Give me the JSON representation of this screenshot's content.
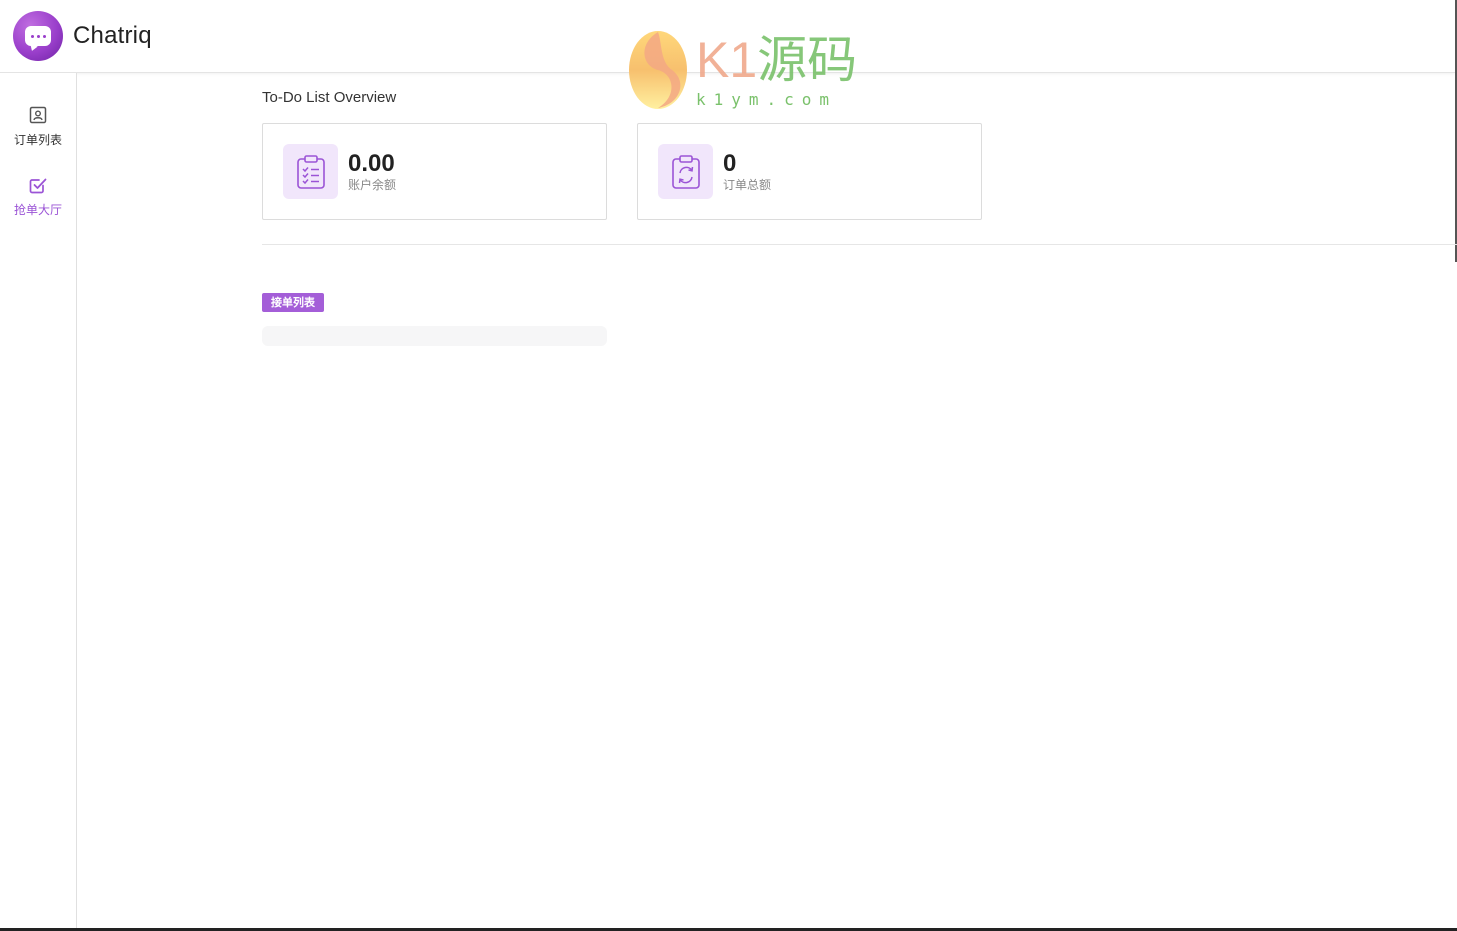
{
  "app": {
    "title": "Chatriq",
    "logo_icon": "chat-bubble-icon",
    "accent_color": "#9b54d6"
  },
  "watermark": {
    "brand_prefix": "K1",
    "brand_cn": "源码",
    "url": "k1ym.com"
  },
  "sidebar": {
    "items": [
      {
        "label": "订单列表",
        "icon": "order-list-icon",
        "active": false
      },
      {
        "label": "抢单大厅",
        "icon": "checkbox-icon",
        "active": true
      }
    ]
  },
  "main": {
    "title": "To-Do List Overview",
    "stats": [
      {
        "value": "0.00",
        "label": "账户余额",
        "icon": "clipboard-checklist-icon"
      },
      {
        "value": "0",
        "label": "订单总额",
        "icon": "clipboard-refresh-icon"
      }
    ],
    "tag_label": "接单列表"
  }
}
